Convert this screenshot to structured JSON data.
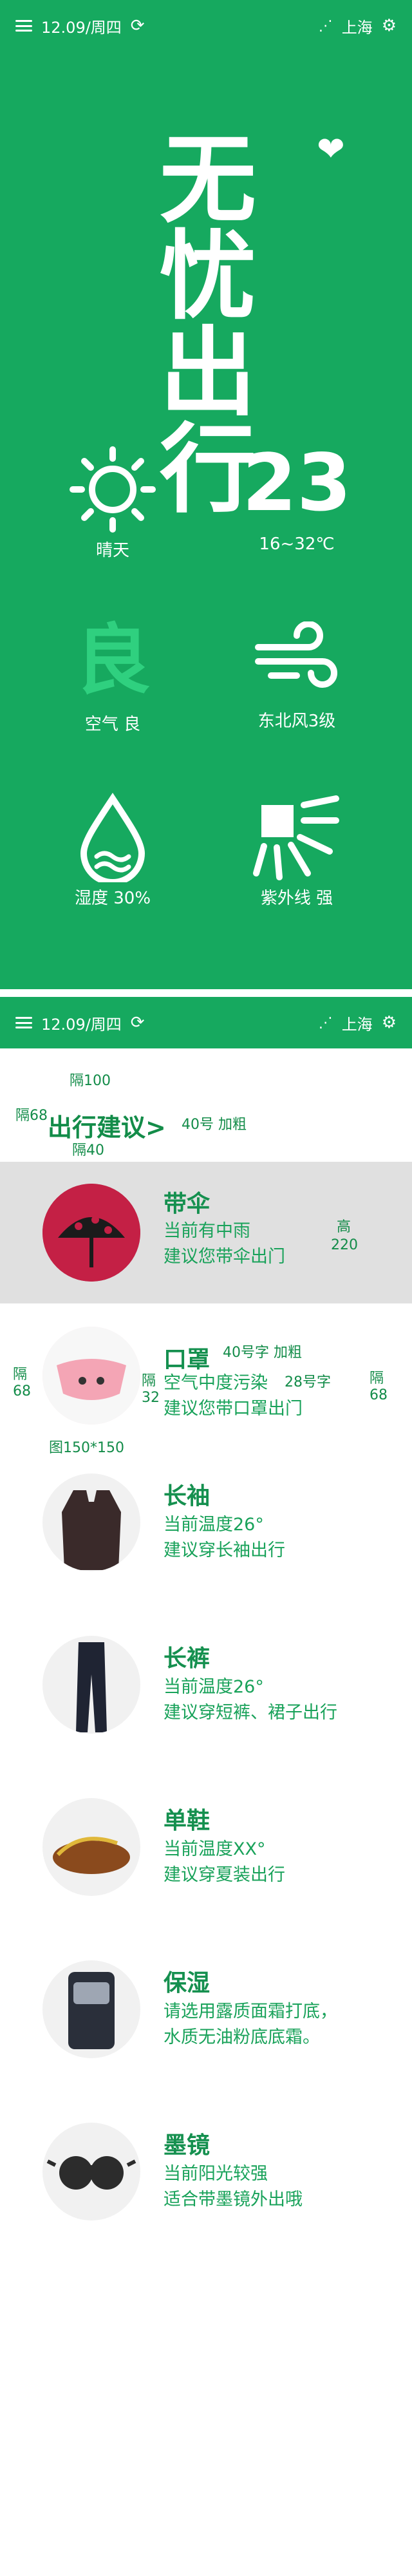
{
  "top_bar": {
    "date": "12.09/周四",
    "city": "上海"
  },
  "brand": {
    "line1": "无忧",
    "line2": "出行"
  },
  "weather": [
    {
      "icon": "sun-icon",
      "label": "晴天"
    },
    {
      "icon": "temperature",
      "value": "23",
      "range": "16~32℃"
    },
    {
      "icon": "air-quality-icon",
      "value": "良",
      "label": "空气 良"
    },
    {
      "icon": "wind-icon",
      "label": "东北风3级"
    },
    {
      "icon": "humidity-drop-icon",
      "label": "湿度 30%"
    },
    {
      "icon": "uv-icon",
      "label": "紫外线 强"
    }
  ],
  "second_bar": {
    "date": "12.09/周四",
    "city": "上海"
  },
  "annotations": {
    "gap100": "隔100",
    "gap68_top": "隔68",
    "gap40": "隔40",
    "title_font": "40号 加粗",
    "height220": "高220",
    "gap68_left": "隔68",
    "item_title_font": "40号字 加粗",
    "gap32": "隔32",
    "desc_font": "28号字",
    "gap68_right": "隔68",
    "image_size": "图150*150"
  },
  "section": {
    "title": "出行建议>"
  },
  "items": [
    {
      "title": "带伞",
      "lines": [
        "当前有中雨",
        "建议您带伞出门"
      ]
    },
    {
      "title": "口罩",
      "lines": [
        "空气中度污染",
        "建议您带口罩出门"
      ]
    },
    {
      "title": "长袖",
      "lines": [
        "当前温度26°",
        "建议穿长袖出行"
      ]
    },
    {
      "title": "长裤",
      "lines": [
        "当前温度26°",
        "建议穿短裤、裙子出行"
      ]
    },
    {
      "title": "单鞋",
      "lines": [
        "当前温度XX°",
        "建议穿夏装出行"
      ]
    },
    {
      "title": "保湿",
      "lines": [
        "请选用露质面霜打底，",
        "水质无油粉底底霜。"
      ]
    },
    {
      "title": "墨镜",
      "lines": [
        "当前阳光较强",
        "适合带墨镜外出哦"
      ]
    }
  ],
  "colors": {
    "green": "#16a95f",
    "text_green": "#15904f",
    "highlight": "#e0e0e0"
  }
}
